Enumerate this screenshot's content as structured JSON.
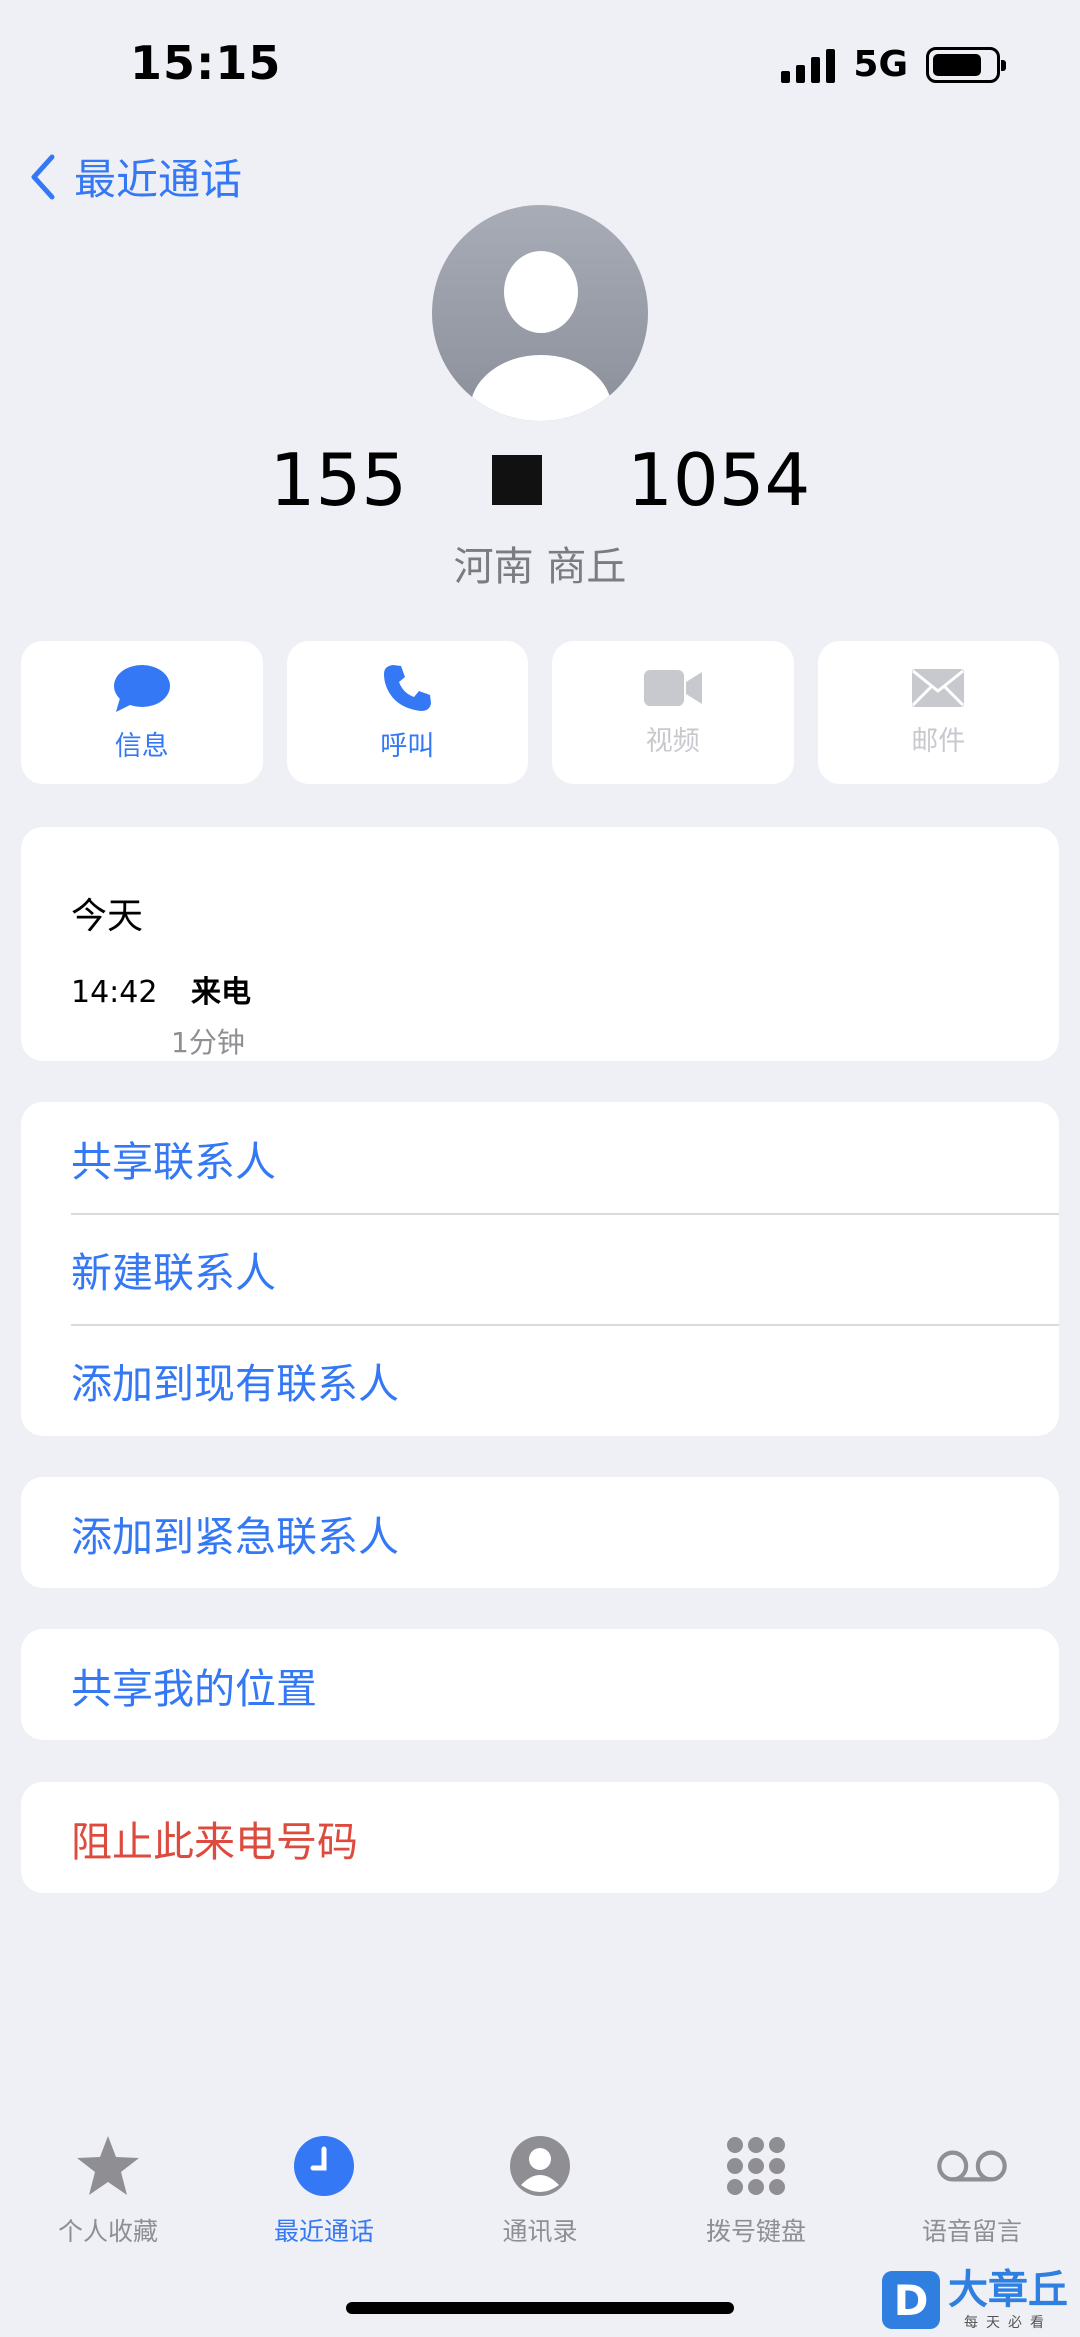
{
  "status_bar": {
    "time": "15:15",
    "network": "5G"
  },
  "nav": {
    "back_label": "最近通话"
  },
  "contact": {
    "number_prefix": "155",
    "number_suffix": "1054",
    "location": "河南 商丘"
  },
  "actions": [
    {
      "label": "信息",
      "icon": "message-icon",
      "enabled": true
    },
    {
      "label": "呼叫",
      "icon": "phone-icon",
      "enabled": true
    },
    {
      "label": "视频",
      "icon": "video-icon",
      "enabled": false
    },
    {
      "label": "邮件",
      "icon": "mail-icon",
      "enabled": false
    }
  ],
  "recent": {
    "day": "今天",
    "time": "14:42",
    "type": "来电",
    "duration": "1分钟"
  },
  "contact_options": [
    "共享联系人",
    "新建联系人",
    "添加到现有联系人"
  ],
  "emergency_option": "添加到紧急联系人",
  "share_location": "共享我的位置",
  "block_option": "阻止此来电号码",
  "tabs": [
    {
      "label": "个人收藏",
      "icon": "star-icon",
      "active": false
    },
    {
      "label": "最近通话",
      "icon": "clock-icon",
      "active": true
    },
    {
      "label": "通讯录",
      "icon": "person-circle-icon",
      "active": false
    },
    {
      "label": "拨号键盘",
      "icon": "keypad-icon",
      "active": false
    },
    {
      "label": "语音留言",
      "icon": "voicemail-icon",
      "active": false
    }
  ],
  "colors": {
    "accent": "#3478f6",
    "destructive": "#dd4b3f",
    "background": "#eff0f5"
  },
  "watermark": {
    "logo_letter": "D",
    "name": "大章丘",
    "tagline": "每天必看"
  }
}
